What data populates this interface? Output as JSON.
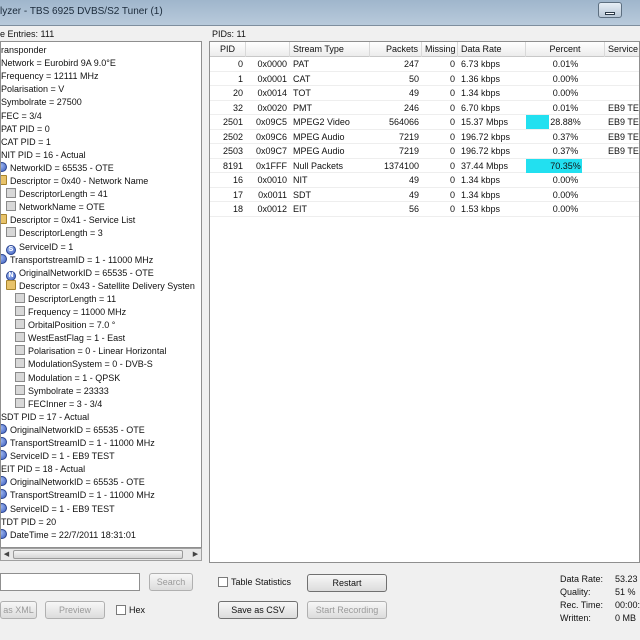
{
  "window": {
    "title": "lyzer - TBS 6925 DVBS/S2 Tuner (1)"
  },
  "left_header": "e Entries: 111",
  "right_header": "PIDs: 11",
  "tree": [
    {
      "label": "ransponder",
      "icon": "none",
      "indent": 0
    },
    {
      "label": "Network = Eurobird 9A 9.0°E",
      "icon": "none",
      "indent": 0
    },
    {
      "label": "Frequency = 12111 MHz",
      "icon": "none",
      "indent": 0
    },
    {
      "label": "Polarisation = V",
      "icon": "none",
      "indent": 0
    },
    {
      "label": "Symbolrate = 27500",
      "icon": "none",
      "indent": 0
    },
    {
      "label": "FEC = 3/4",
      "icon": "none",
      "indent": 0
    },
    {
      "label": "PAT PID = 0",
      "icon": "none",
      "indent": 0
    },
    {
      "label": "CAT PID = 1",
      "icon": "none",
      "indent": 0
    },
    {
      "label": "NIT PID = 16 - Actual",
      "icon": "none",
      "indent": 0
    },
    {
      "label": "NetworkID = 65535 - OTE",
      "icon": "round",
      "indent": 0
    },
    {
      "label": "Descriptor = 0x40 - Network Name",
      "icon": "folder",
      "indent": 0
    },
    {
      "label": "DescriptorLength = 41",
      "icon": "leaf",
      "indent": 1
    },
    {
      "label": "NetworkName = OTE",
      "icon": "leaf",
      "indent": 1
    },
    {
      "label": "Descriptor = 0x41 - Service List",
      "icon": "folder",
      "indent": 0
    },
    {
      "label": "DescriptorLength = 3",
      "icon": "leaf",
      "indent": 1
    },
    {
      "label": "ServiceID = 1",
      "icon": "round-s",
      "indent": 1
    },
    {
      "label": "TransportstreamID = 1 - 11000 MHz",
      "icon": "round",
      "indent": 0
    },
    {
      "label": "OriginalNetworkID = 65535 - OTE",
      "icon": "round-n",
      "indent": 1
    },
    {
      "label": "Descriptor = 0x43 - Satellite Delivery Systen",
      "icon": "folder",
      "indent": 1
    },
    {
      "label": "DescriptorLength = 11",
      "icon": "leaf",
      "indent": 2
    },
    {
      "label": "Frequency = 11000 MHz",
      "icon": "leaf",
      "indent": 2
    },
    {
      "label": "OrbitalPosition = 7.0 °",
      "icon": "leaf",
      "indent": 2
    },
    {
      "label": "WestEastFlag = 1 - East",
      "icon": "leaf",
      "indent": 2
    },
    {
      "label": "Polarisation = 0 - Linear Horizontal",
      "icon": "leaf",
      "indent": 2
    },
    {
      "label": "ModulationSystem = 0 - DVB-S",
      "icon": "leaf",
      "indent": 2
    },
    {
      "label": "Modulation = 1 - QPSK",
      "icon": "leaf",
      "indent": 2
    },
    {
      "label": "Symbolrate = 23333",
      "icon": "leaf",
      "indent": 2
    },
    {
      "label": "FECInner = 3 - 3/4",
      "icon": "leaf",
      "indent": 2
    },
    {
      "label": "SDT PID = 17 - Actual",
      "icon": "none",
      "indent": 0
    },
    {
      "label": "OriginalNetworkID = 65535 - OTE",
      "icon": "round",
      "indent": 0
    },
    {
      "label": "TransportStreamID = 1 - 11000 MHz",
      "icon": "round",
      "indent": 0
    },
    {
      "label": "ServiceID = 1 - EB9 TEST",
      "icon": "round",
      "indent": 0
    },
    {
      "label": "EIT PID = 18 - Actual",
      "icon": "none",
      "indent": 0
    },
    {
      "label": "OriginalNetworkID = 65535 - OTE",
      "icon": "round",
      "indent": 0
    },
    {
      "label": "TransportStreamID = 1 - 11000 MHz",
      "icon": "round",
      "indent": 0
    },
    {
      "label": "ServiceID = 1 - EB9 TEST",
      "icon": "round",
      "indent": 0
    },
    {
      "label": "TDT PID = 20",
      "icon": "none",
      "indent": 0
    },
    {
      "label": "DateTime = 22/7/2011 18:31:01",
      "icon": "round",
      "indent": 0
    }
  ],
  "columns": [
    "PID",
    "",
    "Stream Type",
    "Packets",
    "Missing",
    "Data Rate",
    "Percent",
    "Service"
  ],
  "rows": [
    {
      "pid": "0",
      "hex": "0x0000",
      "type": "PAT",
      "packets": "247",
      "missing": "0",
      "rate": "6.73 kbps",
      "pct": "0.01%",
      "pct_value": 0.01,
      "service": ""
    },
    {
      "pid": "1",
      "hex": "0x0001",
      "type": "CAT",
      "packets": "50",
      "missing": "0",
      "rate": "1.36 kbps",
      "pct": "0.00%",
      "pct_value": 0,
      "service": ""
    },
    {
      "pid": "20",
      "hex": "0x0014",
      "type": "TOT",
      "packets": "49",
      "missing": "0",
      "rate": "1.34 kbps",
      "pct": "0.00%",
      "pct_value": 0,
      "service": ""
    },
    {
      "pid": "32",
      "hex": "0x0020",
      "type": "PMT",
      "packets": "246",
      "missing": "0",
      "rate": "6.70 kbps",
      "pct": "0.01%",
      "pct_value": 0.01,
      "service": "EB9 TE"
    },
    {
      "pid": "2501",
      "hex": "0x09C5",
      "type": "MPEG2 Video",
      "packets": "564066",
      "missing": "0",
      "rate": "15.37 Mbps",
      "pct": "28.88%",
      "pct_value": 28.88,
      "service": "EB9 TE"
    },
    {
      "pid": "2502",
      "hex": "0x09C6",
      "type": "MPEG Audio",
      "packets": "7219",
      "missing": "0",
      "rate": "196.72 kbps",
      "pct": "0.37%",
      "pct_value": 0.37,
      "service": "EB9 TE"
    },
    {
      "pid": "2503",
      "hex": "0x09C7",
      "type": "MPEG Audio",
      "packets": "7219",
      "missing": "0",
      "rate": "196.72 kbps",
      "pct": "0.37%",
      "pct_value": 0.37,
      "service": "EB9 TE"
    },
    {
      "pid": "8191",
      "hex": "0x1FFF",
      "type": "Null Packets",
      "packets": "1374100",
      "missing": "0",
      "rate": "37.44 Mbps",
      "pct": "70.35%",
      "pct_value": 70.35,
      "service": ""
    },
    {
      "pid": "16",
      "hex": "0x0010",
      "type": "NIT",
      "packets": "49",
      "missing": "0",
      "rate": "1.34 kbps",
      "pct": "0.00%",
      "pct_value": 0,
      "service": ""
    },
    {
      "pid": "17",
      "hex": "0x0011",
      "type": "SDT",
      "packets": "49",
      "missing": "0",
      "rate": "1.34 kbps",
      "pct": "0.00%",
      "pct_value": 0,
      "service": ""
    },
    {
      "pid": "18",
      "hex": "0x0012",
      "type": "EIT",
      "packets": "56",
      "missing": "0",
      "rate": "1.53 kbps",
      "pct": "0.00%",
      "pct_value": 0,
      "service": ""
    }
  ],
  "controls": {
    "search_button": "Search",
    "as_xml_button": "as XML",
    "preview_button": "Preview",
    "hex_label": "Hex",
    "table_stats_label": "Table Statistics",
    "restart_button": "Restart",
    "save_csv_button": "Save as CSV",
    "start_recording_button": "Start Recording"
  },
  "stats": {
    "data_rate_label": "Data Rate:",
    "data_rate_value": "53.23",
    "quality_label": "Quality:",
    "quality_value": "51 %",
    "rec_time_label": "Rec. Time:",
    "rec_time_value": "00:00:",
    "written_label": "Written:",
    "written_value": "0 MB"
  },
  "colors": {
    "percent_bar": "#22e0f0"
  }
}
